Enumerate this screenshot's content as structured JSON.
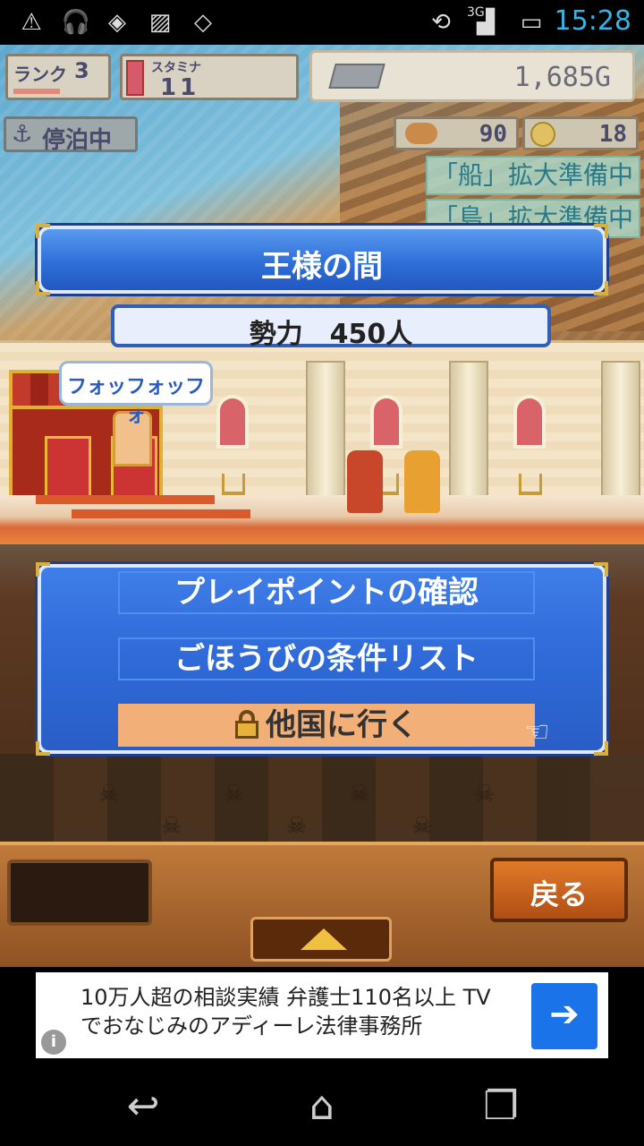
{
  "status_bar": {
    "time": "15:28",
    "network": "3G",
    "icons": [
      "warning-icon",
      "headset-icon",
      "vpn-shield-icon",
      "image-icon",
      "dropbox-icon",
      "rotate-icon",
      "signal-icon",
      "battery-icon"
    ]
  },
  "hud": {
    "rank_label": "ランク",
    "rank_value": "3",
    "stamina_label": "スタミナ",
    "stamina_value": "11",
    "gold": "1,685G",
    "anchor_status": "停泊中",
    "food": "90",
    "coin": "18"
  },
  "notices": [
    "「船」拡大準備中",
    "「島」拡大準備中"
  ],
  "title": "王様の間",
  "power": "勢力　450人",
  "speech": "フォッフォッフォ",
  "menu": {
    "items": [
      {
        "label": "プレイポイントの確認",
        "locked": false,
        "selected": false
      },
      {
        "label": "ごほうびの条件リスト",
        "locked": false,
        "selected": false
      },
      {
        "label": "他国に行く",
        "locked": true,
        "selected": true
      }
    ]
  },
  "buttons": {
    "back": "戻る"
  },
  "ad": {
    "line1": "10万人超の相談実績 弁護士110名以上 TV",
    "line2": "でおなじみのアディーレ法律事務所",
    "info": "i",
    "arrow": "➔"
  },
  "colors": {
    "banner_blue": "#2f6fd8",
    "selected_orange": "#f2b078",
    "status_time": "#33b5e5"
  }
}
